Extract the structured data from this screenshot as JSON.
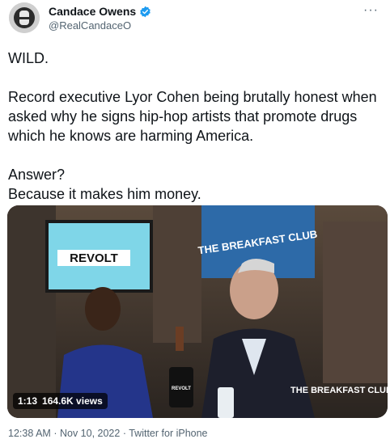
{
  "author": {
    "display_name": "Candace Owens",
    "handle": "@RealCandaceO",
    "verified": true
  },
  "more_label": "···",
  "tweet": {
    "lines": [
      "WILD.",
      "Record executive Lyor Cohen being brutally honest when asked why he signs hip-hop artists that promote drugs which he knows are harming America.",
      "Answer?",
      "Because it makes him money."
    ]
  },
  "video": {
    "duration": "1:13",
    "views": "164.6K views",
    "screen_logo": "REVOLT",
    "banner_text": "THE BREAKFAST CLUB",
    "watermark": "THE BREAKFAST CLUB",
    "mic_label": "REVOLT"
  },
  "meta": {
    "time": "12:38 AM",
    "date": "Nov 10, 2022",
    "source": "Twitter for iPhone",
    "separator": "·"
  },
  "colors": {
    "verified": "#1d9bf0",
    "secondary_text": "#536471"
  }
}
